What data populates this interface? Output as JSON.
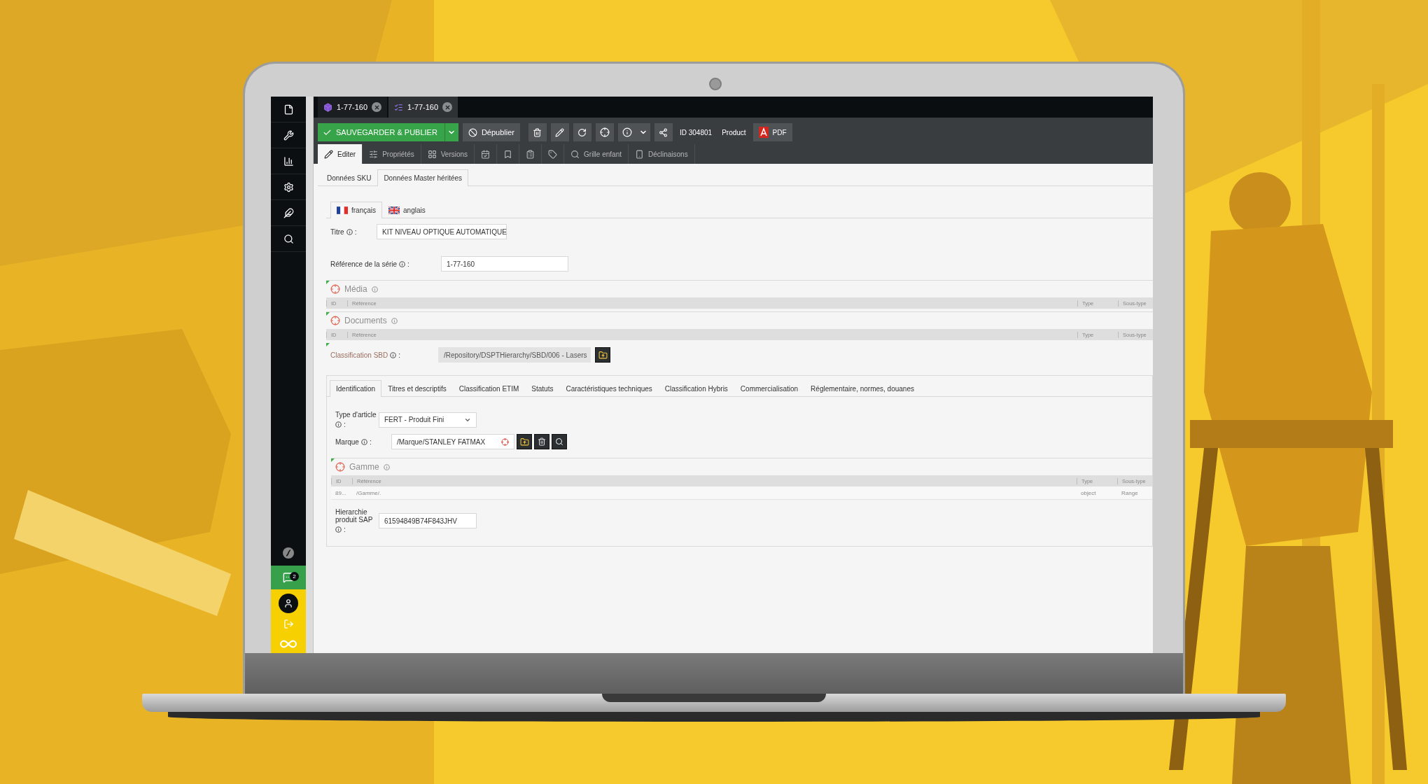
{
  "app_tabs": [
    {
      "label": "1-77-160",
      "selected": false
    },
    {
      "label": "1-77-160",
      "selected": true
    }
  ],
  "chat_badge": "2",
  "toolbar": {
    "save": "SAUVEGARDER & PUBLIER",
    "unpublish": "Dépublier",
    "id": "ID 304801",
    "type": "Product",
    "pdf": "PDF"
  },
  "view_tabs": [
    {
      "label": "Editer",
      "selected": true
    },
    {
      "label": "Propriétés",
      "selected": false
    },
    {
      "label": "Versions",
      "selected": false
    },
    {
      "selected": false
    },
    {
      "selected": false
    },
    {
      "selected": false
    },
    {
      "selected": false
    },
    {
      "label": "Grille enfant",
      "selected": false
    },
    {
      "label": "Déclinaisons",
      "selected": false
    }
  ],
  "data_tabs": [
    {
      "label": "Données SKU",
      "selected": false
    },
    {
      "label": "Données Master héritées",
      "selected": true
    }
  ],
  "language_tabs": [
    {
      "label": "français",
      "selected": true
    },
    {
      "label": "anglais",
      "selected": false
    }
  ],
  "title_field": {
    "label": "Titre",
    "colon": ":",
    "value": "KIT NIVEAU OPTIQUE AUTOMATIQUE"
  },
  "series_field": {
    "label": "Référence de la série",
    "colon": ":",
    "value": "1-77-160"
  },
  "relation_blocks": [
    {
      "title": "Média",
      "columns": [
        "ID",
        "Référence",
        "Type",
        "Sous-type"
      ]
    },
    {
      "title": "Documents",
      "columns": [
        "ID",
        "Référence",
        "Type",
        "Sous-type"
      ]
    }
  ],
  "classification": {
    "label": "Classification SBD",
    "colon": ":",
    "value": "/Repository/DSPTHierarchy/SBD/006 - Lasers",
    "disabled": true
  },
  "section_tabs": [
    {
      "label": "Identification",
      "selected": true
    },
    {
      "label": "Titres et descriptifs",
      "selected": false
    },
    {
      "label": "Classification ETIM",
      "selected": false
    },
    {
      "label": "Statuts",
      "selected": false
    },
    {
      "label": "Caractéristiques techniques",
      "selected": false
    },
    {
      "label": "Classification Hybris",
      "selected": false
    },
    {
      "label": "Commercialisation",
      "selected": false
    },
    {
      "label": "Réglementaire, normes, douanes",
      "selected": false
    }
  ],
  "article_type": {
    "label": "Type d'article",
    "colon": ":",
    "value": "FERT - Produit Fini"
  },
  "brand": {
    "label": "Marque",
    "colon": ":",
    "value": "/Marque/STANLEY FATMAX"
  },
  "range_block": {
    "title": "Gamme",
    "columns": [
      "ID",
      "Référence",
      "Type",
      "Sous-type"
    ],
    "rows": [
      [
        "89...",
        "/Gamme/.",
        "object",
        "Range"
      ]
    ]
  },
  "sap_field": {
    "label": "Hierarchie produit SAP",
    "colon": ":",
    "value": "61594849B74F843JHV"
  }
}
